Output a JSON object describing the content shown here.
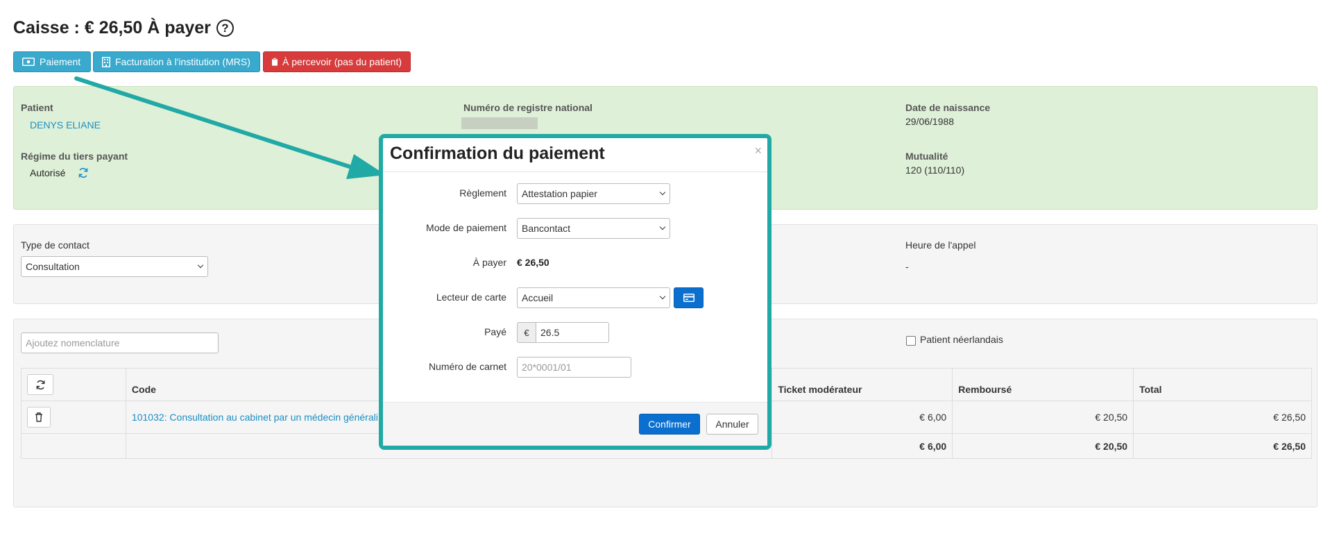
{
  "header": {
    "title": "Caisse : € 26,50 À payer",
    "help_icon": "?"
  },
  "actions": {
    "payment": "Paiement",
    "billing_institution": "Facturation à l'institution (MRS)",
    "to_collect": "À percevoir (pas du patient)"
  },
  "patient": {
    "patient_label": "Patient",
    "patient_name": "DENYS ELIANE",
    "nrn_label": "Numéro de registre national",
    "birth_label": "Date de naissance",
    "birth_value": "29/06/1988",
    "regime_label": "Régime du tiers payant",
    "regime_value": "Autorisé",
    "mutuality_label": "Mutualité",
    "mutuality_value": "120 (110/110)"
  },
  "contact": {
    "type_label": "Type de contact",
    "type_value": "Consultation",
    "call_time_label": "Heure de l'appel",
    "call_time_value": "-"
  },
  "nomenclature": {
    "placeholder": "Ajoutez nomenclature",
    "dutch_patient_label": "Patient néerlandais"
  },
  "table": {
    "headers": {
      "code": "Code",
      "ticket": "Ticket modérateur",
      "refunded": "Remboursé",
      "total": "Total"
    },
    "rows": [
      {
        "code": "101032: Consultation au cabinet par un médecin générali",
        "ticket": "€ 6,00",
        "refunded": "€ 20,50",
        "total": "€ 26,50"
      }
    ],
    "totals": {
      "ticket": "€ 6,00",
      "refunded": "€ 20,50",
      "total": "€ 26,50"
    }
  },
  "modal": {
    "title": "Confirmation du paiement",
    "close": "×",
    "settlement_label": "Règlement",
    "settlement_value": "Attestation papier",
    "payment_mode_label": "Mode de paiement",
    "payment_mode_value": "Bancontact",
    "to_pay_label": "À payer",
    "to_pay_value": "€ 26,50",
    "card_reader_label": "Lecteur de carte",
    "card_reader_value": "Accueil",
    "paid_label": "Payé",
    "paid_currency": "€",
    "paid_value": "26.5",
    "booklet_label": "Numéro de carnet",
    "booklet_placeholder": "20*0001/01",
    "confirm": "Confirmer",
    "cancel": "Annuler"
  },
  "colors": {
    "info": "#39a9cd",
    "danger": "#d73b3b",
    "primary": "#0b6fcf",
    "success_bg": "#dff0d8",
    "annotation": "#20a9a5"
  }
}
